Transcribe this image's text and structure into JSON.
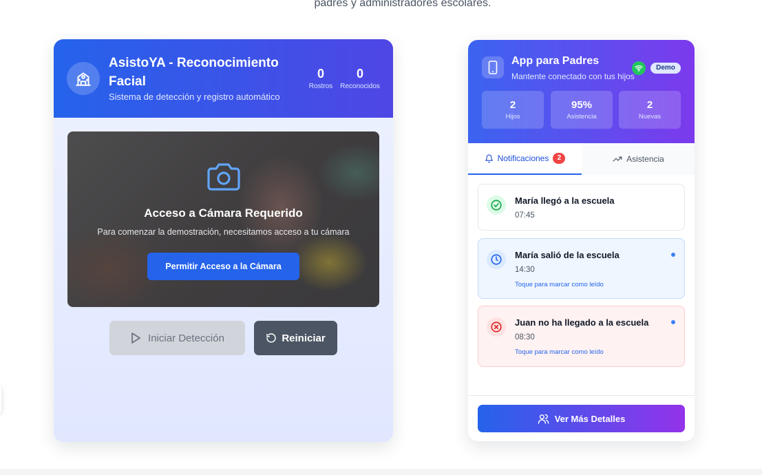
{
  "intro": {
    "text": "padres y administradores escolares."
  },
  "facial_card": {
    "title": "AsistoYA - Reconocimiento Facial",
    "subtitle": "Sistema de detección y registro automático",
    "stats": [
      {
        "value": "0",
        "label": "Rostros"
      },
      {
        "value": "0",
        "label": "Reconocidos"
      }
    ],
    "camera": {
      "title": "Acceso a Cámara Requerido",
      "description": "Para comenzar la demostración, necesitamos acceso a tu cámara",
      "button_label": "Permitir Acceso a la Cámara"
    },
    "start_label": "Iniciar Detección",
    "reset_label": "Reiniciar"
  },
  "parent_app": {
    "title": "App para Padres",
    "subtitle": "Mantente conectado con tus hijos",
    "demo_badge": "Demo",
    "stats": [
      {
        "value": "2",
        "label": "Hijos"
      },
      {
        "value": "95%",
        "label": "Asistencia"
      },
      {
        "value": "2",
        "label": "Nuevas"
      }
    ],
    "tabs": {
      "notifications": "Notificaciones",
      "notifications_count": "2",
      "attendance": "Asistencia"
    },
    "notifications": [
      {
        "title": "María llegó a la escuela",
        "time": "07:45",
        "hint": "",
        "status": "success"
      },
      {
        "title": "María salió de la escuela",
        "time": "14:30",
        "hint": "Toque para marcar como leído",
        "status": "info"
      },
      {
        "title": "Juan no ha llegado a la escuela",
        "time": "08:30",
        "hint": "Toque para marcar como leído",
        "status": "alert"
      }
    ],
    "more_button": "Ver Más Detalles"
  },
  "colors": {
    "primary": "#2563eb",
    "purple": "#7c3aed",
    "success": "#22c55e",
    "danger": "#ef4444"
  }
}
